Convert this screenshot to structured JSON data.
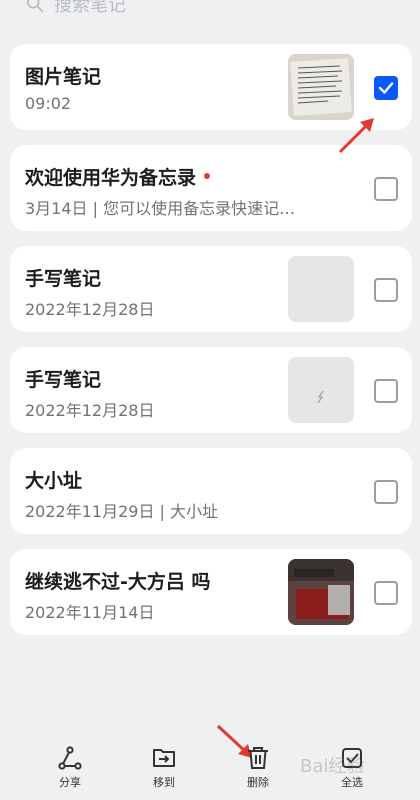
{
  "search": {
    "placeholder": "搜索笔记",
    "icon": "search-icon"
  },
  "notes": [
    {
      "title": "图片笔记",
      "subtitle": "09:02",
      "thumbnail": "document-photo",
      "checked": true
    },
    {
      "title": "欢迎使用华为备忘录",
      "subtitle": "3月14日 | 您可以使用备忘录快速记…",
      "thumbnail": "",
      "checked": false,
      "unread": true
    },
    {
      "title": "手写笔记",
      "subtitle": "2022年12月28日",
      "thumbnail": "blank",
      "checked": false
    },
    {
      "title": "手写笔记",
      "subtitle": "2022年12月28日",
      "thumbnail": "blank-sketch",
      "checked": false
    },
    {
      "title": "大小址",
      "subtitle": "2022年11月29日 | 大小址",
      "thumbnail": "",
      "checked": false
    },
    {
      "title": "继续逃不过-大方吕 吗",
      "subtitle": "2022年11月14日",
      "thumbnail": "photo",
      "checked": false
    }
  ],
  "toolbar": {
    "share_label": "分享",
    "move_label": "移到",
    "delete_label": "删除",
    "select_all_label": "全选"
  },
  "accent_color": "#0a59f7",
  "watermark": "Bai经验"
}
